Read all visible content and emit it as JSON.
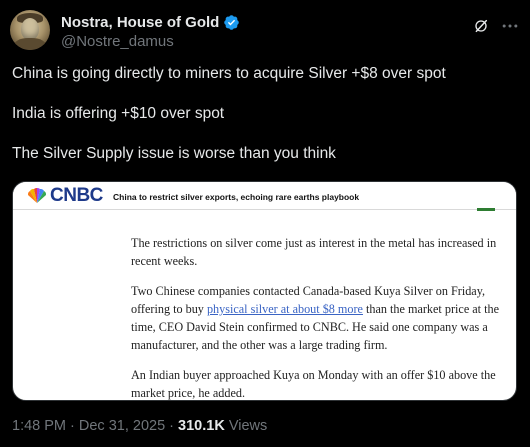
{
  "author": {
    "display_name": "Nostra, House of Gold",
    "handle": "@Nostre_damus",
    "verified_color": "#1d9bf0"
  },
  "icons": [
    "avatar",
    "verified-badge-icon",
    "grok-icon",
    "more-icon",
    "cnbc-peacock-icon"
  ],
  "tweet": {
    "lines": [
      "China is going directly to miners to acquire Silver +$8 over spot",
      "India is offering +$10 over spot",
      "The Silver Supply issue is worse than you think"
    ]
  },
  "media": {
    "brand": "CNBC",
    "headline": "China to restrict silver exports, echoing rare earths playbook",
    "paragraphs": [
      {
        "text": "The restrictions on silver come just as interest in the metal has increased in recent weeks."
      },
      {
        "before": "Two Chinese companies contacted Canada-based Kuya Silver on Friday, offering to buy ",
        "link": "physical silver at about $8 more",
        "after": " than the market price at the time, CEO David Stein confirmed to CNBC. He said one company was a manufacturer, and the other was a large trading firm."
      },
      {
        "text": "An Indian buyer approached Kuya on Monday with an offer $10 above the market price, he added."
      }
    ]
  },
  "meta": {
    "time": "1:48 PM",
    "sep1": " · ",
    "date": "Dec 31, 2025",
    "sep2": " · ",
    "views_count": "310.1K",
    "views_label": " Views"
  }
}
